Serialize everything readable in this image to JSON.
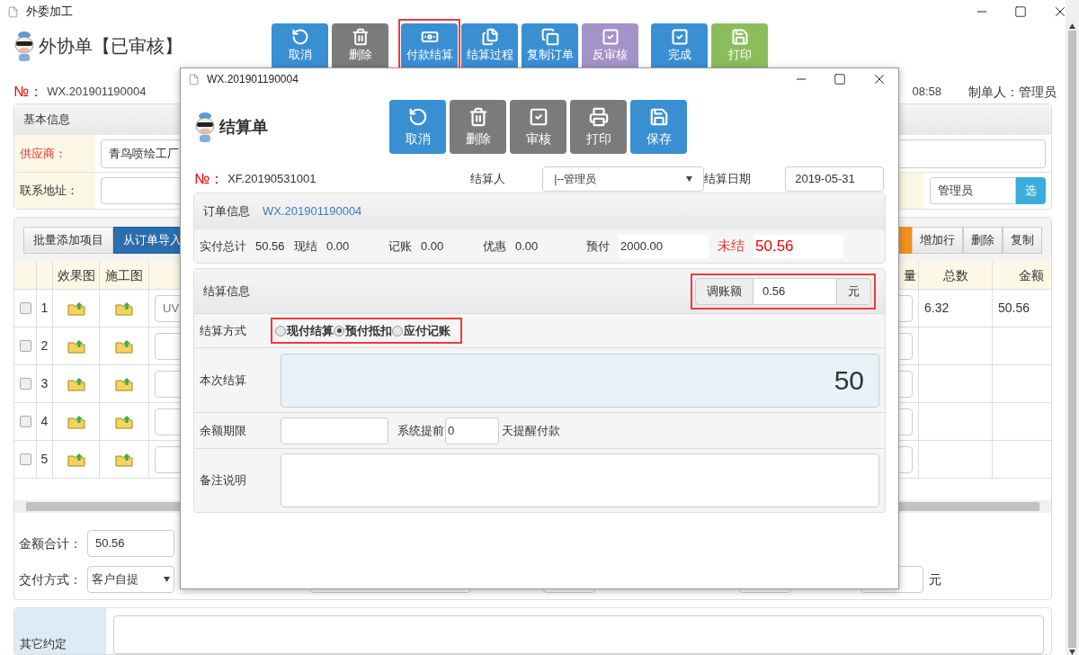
{
  "window": {
    "title": "外委加工"
  },
  "header": {
    "title": "外协单【已审核】",
    "number_label": "№：",
    "number": "WX.201901190004",
    "time": "08:58",
    "creator": "制单人：管理员"
  },
  "toolbar": [
    {
      "label": "取消",
      "kind": "primary",
      "highlighted": false
    },
    {
      "label": "删除",
      "kind": "gray",
      "highlighted": false
    },
    {
      "label": "付款结算",
      "kind": "primary",
      "highlighted": true
    },
    {
      "label": "结算过程",
      "kind": "primary",
      "highlighted": false
    },
    {
      "label": "复制订单",
      "kind": "primary",
      "highlighted": false
    },
    {
      "label": "反审核",
      "kind": "purple",
      "highlighted": false
    },
    {
      "label": "完成",
      "kind": "primary",
      "highlighted": false
    },
    {
      "label": "打印",
      "kind": "success",
      "highlighted": false
    }
  ],
  "basic_info": {
    "title": "基本信息",
    "supplier_label": "供应商：",
    "supplier": "青鸟喷绘工厂",
    "address_label": "联系地址：",
    "handler": "管理员",
    "pick": "选"
  },
  "items": {
    "left_buttons": [
      {
        "label": "批量添加项目",
        "selected": false
      },
      {
        "label": "从订单导入",
        "selected": true
      }
    ],
    "right_buttons": [
      "增加行",
      "删除",
      "复制"
    ],
    "columns": [
      "效果图",
      "施工图",
      "量",
      "总数",
      "金额"
    ],
    "rows": [
      {
        "checked": false,
        "no": "1",
        "column_5": "UV",
        "total": "6.32",
        "amount": "50.56"
      },
      {
        "checked": false,
        "no": "2"
      },
      {
        "checked": false,
        "no": "3"
      },
      {
        "checked": false,
        "no": "4"
      },
      {
        "checked": false,
        "no": "5"
      }
    ]
  },
  "totals": {
    "amount_label": "金额合计：",
    "amount": "50.56",
    "delivery_label": "交付方式：",
    "delivery": "客户自提",
    "unit": "元"
  },
  "other": {
    "label": "其它约定"
  },
  "dialog": {
    "title": "WX.201901190004",
    "heading": "结算单",
    "buttons": [
      {
        "label": "取消",
        "kind": "primary"
      },
      {
        "label": "删除",
        "kind": "gray"
      },
      {
        "label": "审核",
        "kind": "gray"
      },
      {
        "label": "打印",
        "kind": "gray"
      },
      {
        "label": "保存",
        "kind": "primary"
      }
    ],
    "number_label": "№：",
    "number": "XF.20190531001",
    "settler_label": "结算人",
    "settler": "|--管理员",
    "date_label": "结算日期",
    "date": "2019-05-31",
    "order": {
      "title": "订单信息",
      "number": "WX.201901190004",
      "summary": [
        {
          "label": "实付总计",
          "value": "50.56"
        },
        {
          "label": "现结",
          "value": "0.00"
        },
        {
          "label": "记账",
          "value": "0.00"
        },
        {
          "label": "优惠",
          "value": "0.00"
        }
      ],
      "prepaid_label": "预付",
      "prepaid": "2000.00",
      "unsettled_label": "未结",
      "unsettled": "50.56"
    },
    "settlement": {
      "title": "结算信息",
      "adjust": {
        "label": "调账额",
        "value": "0.56",
        "unit": "元",
        "highlighted": true
      },
      "method_label": "结算方式",
      "methods_highlighted": true,
      "methods": [
        {
          "label": "现付结算",
          "selected": false
        },
        {
          "label": "预付抵扣",
          "selected": true
        },
        {
          "label": "应付记账",
          "selected": false
        }
      ],
      "current_label": "本次结算",
      "current": "50",
      "deadline_label": "余额期限",
      "remind_prefix": "系统提前",
      "remind_days": "0",
      "remind_suffix": "天提醒付款",
      "remark_label": "备注说明"
    }
  }
}
